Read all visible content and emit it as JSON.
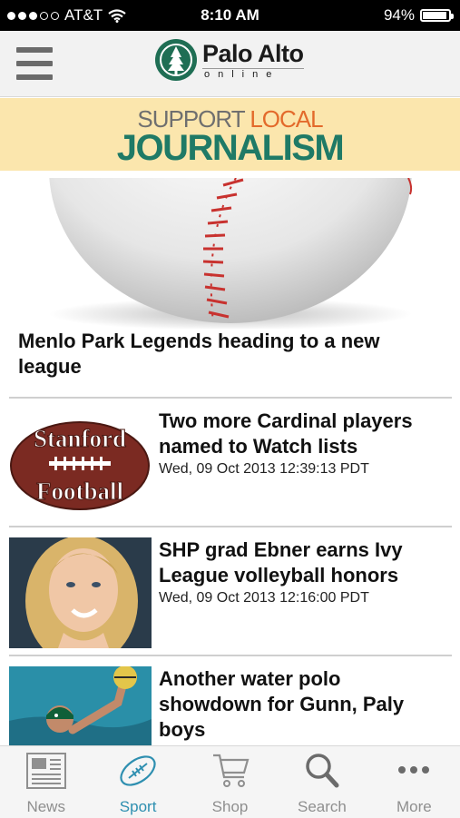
{
  "status_bar": {
    "carrier": "AT&T",
    "time": "8:10 AM",
    "battery": "94%",
    "battery_level": 0.94
  },
  "header": {
    "logo_title": "Palo Alto",
    "logo_subtitle": "online",
    "menu_icon": "hamburger-icon"
  },
  "banner": {
    "line1_a": "SUPPORT ",
    "line1_b": "LOCAL",
    "line2": "JOURNALISM",
    "colors": {
      "gray": "#6f6f6f",
      "orange": "#e36a2b",
      "green": "#1f7a66",
      "bg": "#fbe6ad"
    }
  },
  "feature": {
    "title": "Menlo Park Legends heading to a new league",
    "image": "baseball"
  },
  "articles": [
    {
      "title": "Two more Cardinal players named to Watch lists",
      "date": "Wed, 09 Oct 2013 12:39:13 PDT",
      "image": "stanford-football-logo",
      "image_text_1": "Stanford",
      "image_text_2": "Football"
    },
    {
      "title": "SHP grad Ebner earns Ivy League volleyball honors",
      "date": "Wed, 09 Oct 2013 12:16:00 PDT",
      "image": "portrait"
    },
    {
      "title": "Another water polo showdown for Gunn, Paly boys",
      "date": "",
      "image": "water-polo"
    }
  ],
  "tabs": [
    {
      "label": "News",
      "icon": "newspaper-icon",
      "active": false
    },
    {
      "label": "Sport",
      "icon": "football-icon",
      "active": true
    },
    {
      "label": "Shop",
      "icon": "cart-icon",
      "active": false
    },
    {
      "label": "Search",
      "icon": "search-icon",
      "active": false
    },
    {
      "label": "More",
      "icon": "more-icon",
      "active": false
    }
  ],
  "accent": "#2e8fb0"
}
